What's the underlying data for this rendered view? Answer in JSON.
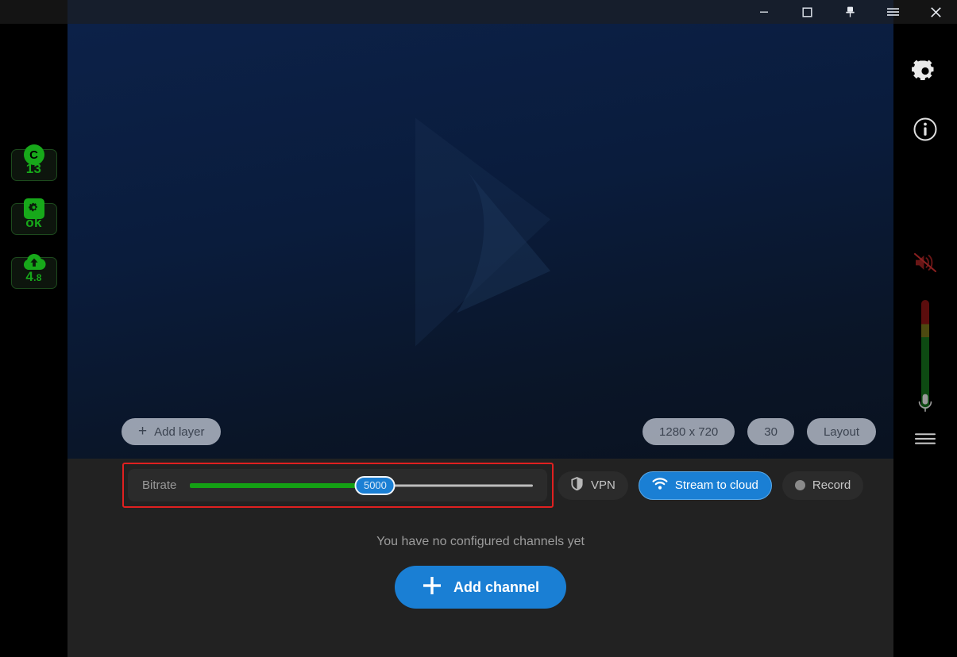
{
  "window": {
    "controls": [
      {
        "name": "minimize",
        "icon": "minimize-icon",
        "label": "Minimize"
      },
      {
        "name": "maximize",
        "icon": "maximize-icon",
        "label": "Maximize"
      },
      {
        "name": "pin",
        "icon": "pin-icon",
        "label": "Always on top"
      },
      {
        "name": "menu",
        "icon": "hamburger-menu-icon",
        "label": "Menu"
      },
      {
        "name": "close",
        "icon": "close-icon",
        "label": "Close"
      }
    ]
  },
  "left_sidebar": {
    "badges": [
      {
        "name": "cpu",
        "icon": "cpu-circle-icon",
        "cap_text": "C",
        "value": "13",
        "decimal": ""
      },
      {
        "name": "status",
        "icon": "gear-icon",
        "cap_text": "",
        "value": "ok",
        "decimal": ""
      },
      {
        "name": "upload",
        "icon": "cloud-upload-icon",
        "cap_text": "",
        "value": "4",
        "decimal": ".8"
      }
    ]
  },
  "right_sidebar": {
    "icons": [
      {
        "name": "settings",
        "icon": "gear-icon"
      },
      {
        "name": "info",
        "icon": "info-circle-icon"
      },
      {
        "name": "speaker",
        "icon": "speaker-muted-icon"
      },
      {
        "name": "microphone",
        "icon": "microphone-icon"
      },
      {
        "name": "menu",
        "icon": "hamburger-menu-icon"
      }
    ],
    "vu_meter": {
      "name": "audio-level-meter",
      "level": 0
    }
  },
  "preview": {
    "watermark": "play-logo-watermark",
    "add_layer_label": "Add layer",
    "add_layer_plus": "+",
    "resolution_label": "1280 x 720",
    "fps_label": "30",
    "layout_label": "Layout"
  },
  "controls": {
    "bitrate_label": "Bitrate",
    "bitrate_value": "5000",
    "bitrate_percent": 54,
    "vpn_label": "VPN",
    "stream_label": "Stream to cloud",
    "record_label": "Record",
    "annotation_color": "#e02020"
  },
  "channels": {
    "empty_message": "You have no configured channels yet",
    "add_channel_label": "Add channel",
    "add_channel_plus": "+"
  },
  "colors": {
    "accent_blue": "#1a7fd4",
    "status_green": "#17a81a",
    "slider_green": "#14a014",
    "panel_dark": "#222222"
  }
}
